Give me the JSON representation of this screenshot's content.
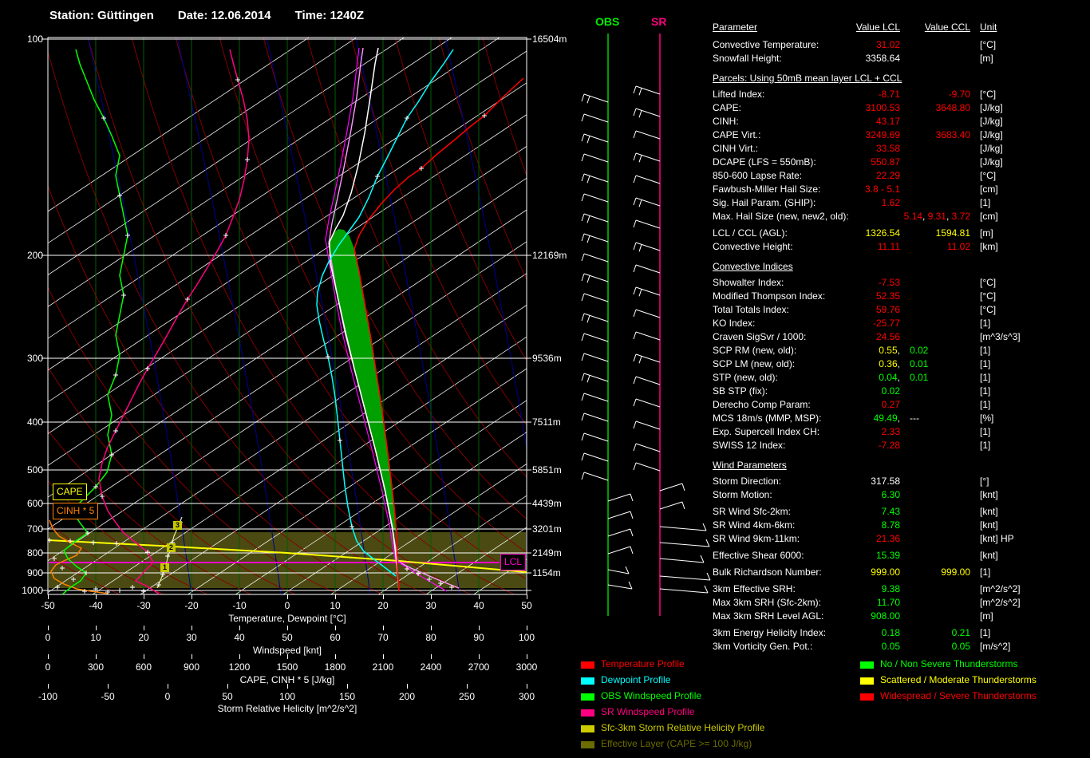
{
  "header": {
    "station": "Station: Güttingen",
    "date": "Date: 12.06.2014",
    "time": "Time: 1240Z"
  },
  "colors": {
    "r": "#ff0000",
    "y": "#ffff00",
    "g": "#00ff00",
    "w": "#ffffff",
    "cyan": "#00ffff",
    "sr_magenta": "#ff0080",
    "obs_green": "#00ff00",
    "srh_yellow": "#cccc00",
    "effective_olive": "#6b6b00",
    "lcl_magenta": "#ff00cc",
    "cinh_orange": "#ff8000",
    "cape_fill": "#00a000"
  },
  "wind_panel": {
    "obs_label": "OBS",
    "sr_label": "SR"
  },
  "chart_labels": {
    "cape_box": "CAPE",
    "cinh_box": "CINH * 5",
    "lcl_box": "LCL",
    "srh_km_markers": [
      "3",
      "2",
      "1"
    ]
  },
  "chart_data": {
    "type": "table",
    "pressure_ticks": [
      "100",
      "200",
      "300",
      "400",
      "500",
      "600",
      "700",
      "800",
      "900",
      "1000"
    ],
    "altitude_ticks": [
      "16504m",
      "12169m",
      "9536m",
      "7511m",
      "5851m",
      "4439m",
      "3201m",
      "2149m",
      "1154m"
    ],
    "axes": [
      {
        "ticks": [
          "-50",
          "-40",
          "-30",
          "-20",
          "-10",
          "0",
          "10",
          "20",
          "30",
          "40",
          "50"
        ],
        "label": "Temperature, Dewpoint [°C]"
      },
      {
        "ticks": [
          "0",
          "10",
          "20",
          "30",
          "40",
          "50",
          "60",
          "70",
          "80",
          "90",
          "100"
        ],
        "label": "Windspeed [knt]"
      },
      {
        "ticks": [
          "0",
          "300",
          "600",
          "900",
          "1200",
          "1500",
          "1800",
          "2100",
          "2400",
          "2700",
          "3000"
        ],
        "label": "CAPE, CINH * 5 [J/kg]"
      },
      {
        "ticks": [
          "-100",
          "-50",
          "0",
          "50",
          "100",
          "150",
          "200",
          "250",
          "300"
        ],
        "label": "Storm Relative Helicity [m^2/s^2]"
      }
    ],
    "columns": [
      "Parameter",
      "Value LCL",
      "Value CCL",
      "Unit"
    ],
    "rows": [
      {
        "l": "Convective Temperature:",
        "v1": [
          [
            "31.02",
            "r"
          ]
        ],
        "u": "[°C]"
      },
      {
        "l": "Snowfall Height:",
        "v1": [
          [
            "3358.64",
            "w"
          ]
        ],
        "u": "[m]"
      },
      {
        "s": "Parcels: Using 50mB mean layer LCL + CCL"
      },
      {
        "l": "Lifted Index:",
        "v1": [
          [
            "-8.71",
            "r"
          ]
        ],
        "v2": [
          [
            "-9.70",
            "r"
          ]
        ],
        "u": "[°C]"
      },
      {
        "l": "CAPE:",
        "v1": [
          [
            "3100.53",
            "r"
          ]
        ],
        "v2": [
          [
            "3648.80",
            "r"
          ]
        ],
        "u": "[J/kg]"
      },
      {
        "l": "CINH:",
        "v1": [
          [
            "43.17",
            "r"
          ]
        ],
        "u": "[J/kg]"
      },
      {
        "l": "CAPE Virt.:",
        "v1": [
          [
            "3249.69",
            "r"
          ]
        ],
        "v2": [
          [
            "3683.40",
            "r"
          ]
        ],
        "u": "[J/kg]"
      },
      {
        "l": "CINH Virt.:",
        "v1": [
          [
            "33.58",
            "r"
          ]
        ],
        "u": "[J/kg]"
      },
      {
        "l": "DCAPE (LFS = 550mB):",
        "v1": [
          [
            "550.87",
            "r"
          ]
        ],
        "u": "[J/kg]"
      },
      {
        "l": "850-600 Lapse Rate:",
        "v1": [
          [
            "22.29",
            "r"
          ]
        ],
        "u": "[°C]"
      },
      {
        "l": "Fawbush-Miller Hail Size:",
        "v1": [
          [
            "3.8 - 5.1",
            "r"
          ]
        ],
        "u": "[cm]"
      },
      {
        "l": "Sig. Hail Param. (SHIP):",
        "v1": [
          [
            "1.62",
            "r"
          ]
        ],
        "u": "[1]"
      },
      {
        "l": "Max. Hail Size (new, new2, old):",
        "v2": [
          [
            "5.14",
            "r"
          ],
          [
            ",  ",
            "w"
          ],
          [
            "9.31",
            "r"
          ],
          [
            ",  ",
            "w"
          ],
          [
            "3.72",
            "r"
          ]
        ],
        "u": "[cm]"
      },
      {
        "l": "LCL / CCL (AGL):",
        "v1": [
          [
            "1326.54",
            "y"
          ]
        ],
        "v2": [
          [
            "1594.81",
            "y"
          ]
        ],
        "u": "[m]",
        "mt": 4
      },
      {
        "l": "Convective Height:",
        "v1": [
          [
            "11.11",
            "r"
          ]
        ],
        "v2": [
          [
            "11.02",
            "r"
          ]
        ],
        "u": "[km]"
      },
      {
        "s": "Convective Indices"
      },
      {
        "l": "Showalter Index:",
        "v1": [
          [
            "-7.53",
            "r"
          ]
        ],
        "u": "[°C]"
      },
      {
        "l": "Modified Thompson Index:",
        "v1": [
          [
            "52.35",
            "r"
          ]
        ],
        "u": "[°C]"
      },
      {
        "l": "Total Totals Index:",
        "v1": [
          [
            "59.76",
            "r"
          ]
        ],
        "u": "[°C]"
      },
      {
        "l": "KO Index:",
        "v1": [
          [
            "-25.77",
            "r"
          ]
        ],
        "u": "[1]"
      },
      {
        "l": "Craven SigSvr / 1000:",
        "v1": [
          [
            "24.56",
            "r"
          ]
        ],
        "u": "[m^3/s^3]"
      },
      {
        "l": "SCP RM (new, old):",
        "v1": [
          [
            "0.55",
            "y"
          ],
          [
            ",",
            "w"
          ]
        ],
        "v2": [
          [
            "0.02",
            "g"
          ]
        ],
        "v2l": true,
        "u": "[1]"
      },
      {
        "l": "SCP LM (new, old):",
        "v1": [
          [
            "0.36",
            "y"
          ],
          [
            ",",
            "w"
          ]
        ],
        "v2": [
          [
            "0.01",
            "g"
          ]
        ],
        "v2l": true,
        "u": "[1]"
      },
      {
        "l": "STP (new, old):",
        "v1": [
          [
            "0.04",
            "g"
          ],
          [
            ",",
            "w"
          ]
        ],
        "v2": [
          [
            "0.01",
            "g"
          ]
        ],
        "v2l": true,
        "u": "[1]"
      },
      {
        "l": "SB STP (fix):",
        "v1": [
          [
            "0.02",
            "g"
          ]
        ],
        "u": "[1]"
      },
      {
        "l": "Derecho Comp Param:",
        "v1": [
          [
            "0.27",
            "r"
          ]
        ],
        "u": "[1]"
      },
      {
        "l": "MCS 18m/s (MMP, MSP):",
        "v1": [
          [
            "49.49",
            "g"
          ],
          [
            ",",
            "w"
          ]
        ],
        "v2": [
          [
            "---",
            "w"
          ]
        ],
        "v2l": true,
        "u": "[%]"
      },
      {
        "l": "Exp. Supercell Index CH:",
        "v1": [
          [
            "2.33",
            "r"
          ]
        ],
        "u": "[1]"
      },
      {
        "l": "SWISS 12 Index:",
        "v1": [
          [
            "-7.28",
            "r"
          ]
        ],
        "u": "[1]"
      },
      {
        "s": "Wind Parameters"
      },
      {
        "l": "Storm Direction:",
        "v1": [
          [
            "317.58",
            "w"
          ]
        ],
        "u": "[°]"
      },
      {
        "l": "Storm Motion:",
        "v1": [
          [
            "6.30",
            "g"
          ]
        ],
        "u": "[knt]"
      },
      {
        "l": "SR Wind Sfc-2km:",
        "v1": [
          [
            "7.43",
            "g"
          ]
        ],
        "u": "[knt]",
        "mt": 4
      },
      {
        "l": "SR Wind 4km-6km:",
        "v1": [
          [
            "8.78",
            "g"
          ]
        ],
        "u": "[knt]"
      },
      {
        "l": "SR Wind 9km-11km:",
        "v1": [
          [
            "21.36",
            "r"
          ]
        ],
        "u": "[knt] HP"
      },
      {
        "l": "Effective Shear 6000:",
        "v1": [
          [
            "15.39",
            "g"
          ]
        ],
        "u": "[knt]",
        "mt": 4
      },
      {
        "l": "Bulk Richardson Number:",
        "v1": [
          [
            "999.00",
            "y"
          ]
        ],
        "v2": [
          [
            "999.00",
            "y"
          ]
        ],
        "u": "[1]",
        "mt": 4
      },
      {
        "l": "3km Effective SRH:",
        "v1": [
          [
            "9.38",
            "g"
          ]
        ],
        "u": "[m^2/s^2]",
        "mt": 4
      },
      {
        "l": "Max 3km SRH (Sfc-2km):",
        "v1": [
          [
            "11.70",
            "g"
          ]
        ],
        "u": "[m^2/s^2]"
      },
      {
        "l": "Max 3km SRH Level AGL:",
        "v1": [
          [
            "908.00",
            "g"
          ]
        ],
        "u": "[m]"
      },
      {
        "l": "3km Energy Helicity Index:",
        "v1": [
          [
            "0.18",
            "g"
          ]
        ],
        "v2": [
          [
            "0.21",
            "g"
          ]
        ],
        "u": "[1]",
        "mt": 4
      },
      {
        "l": "3km Vorticity Gen. Pot.:",
        "v1": [
          [
            "0.05",
            "g"
          ]
        ],
        "v2": [
          [
            "0.05",
            "g"
          ]
        ],
        "u": "[m/s^2]"
      }
    ]
  },
  "legend_left": [
    {
      "t": "Temperature Profile",
      "c": "#ff0000"
    },
    {
      "t": "Dewpoint Profile",
      "c": "#00ffff"
    },
    {
      "t": "OBS Windspeed Profile",
      "c": "#00ff00"
    },
    {
      "t": "SR Windspeed Profile",
      "c": "#ff0080"
    },
    {
      "t": "Sfc-3km Storm Relative Helicity Profile",
      "c": "#cccc00"
    },
    {
      "t": "Effective Layer (CAPE >= 100 J/kg)",
      "c": "#6b6b00"
    }
  ],
  "legend_right": [
    {
      "t": "No / Non Severe Thunderstorms",
      "c": "#00ff00"
    },
    {
      "t": "Scattered / Moderate Thunderstorms",
      "c": "#ffff00"
    },
    {
      "t": "Widespread / Severe Thunderstorms",
      "c": "#ff0000"
    }
  ]
}
